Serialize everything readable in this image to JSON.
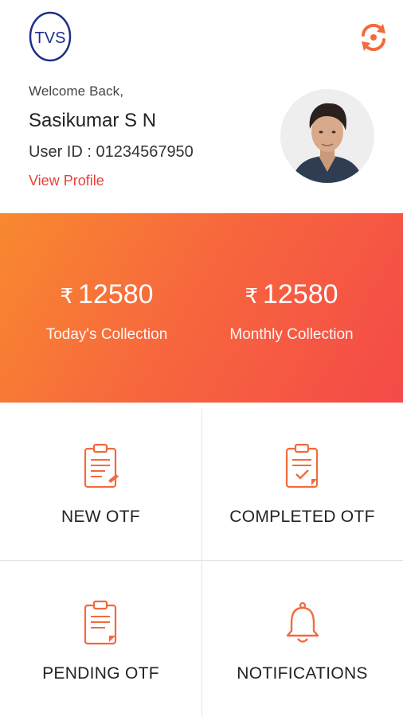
{
  "header": {
    "logo_text": "TVS",
    "welcome_text": "Welcome Back,",
    "user_name": "Sasikumar S N",
    "user_id": "User ID : 01234567950",
    "view_profile_label": "View Profile",
    "sync_icon": "sync-icon"
  },
  "collections": {
    "currency_symbol": "₹",
    "today": {
      "value": "12580",
      "label": "Today's Collection"
    },
    "monthly": {
      "value": "12580",
      "label": "Monthly Collection"
    }
  },
  "menu": {
    "items": [
      {
        "label": "NEW OTF",
        "icon": "clipboard-new-icon"
      },
      {
        "label": "COMPLETED OTF",
        "icon": "clipboard-check-icon"
      },
      {
        "label": "PENDING OTF",
        "icon": "clipboard-pending-icon"
      },
      {
        "label": "NOTIFICATIONS",
        "icon": "bell-icon"
      }
    ]
  },
  "colors": {
    "accent": "#f36a3d",
    "gradient_start": "#f8892f",
    "gradient_end": "#f44a48",
    "link": "#e8423a",
    "logo_blue": "#1c2f86"
  }
}
